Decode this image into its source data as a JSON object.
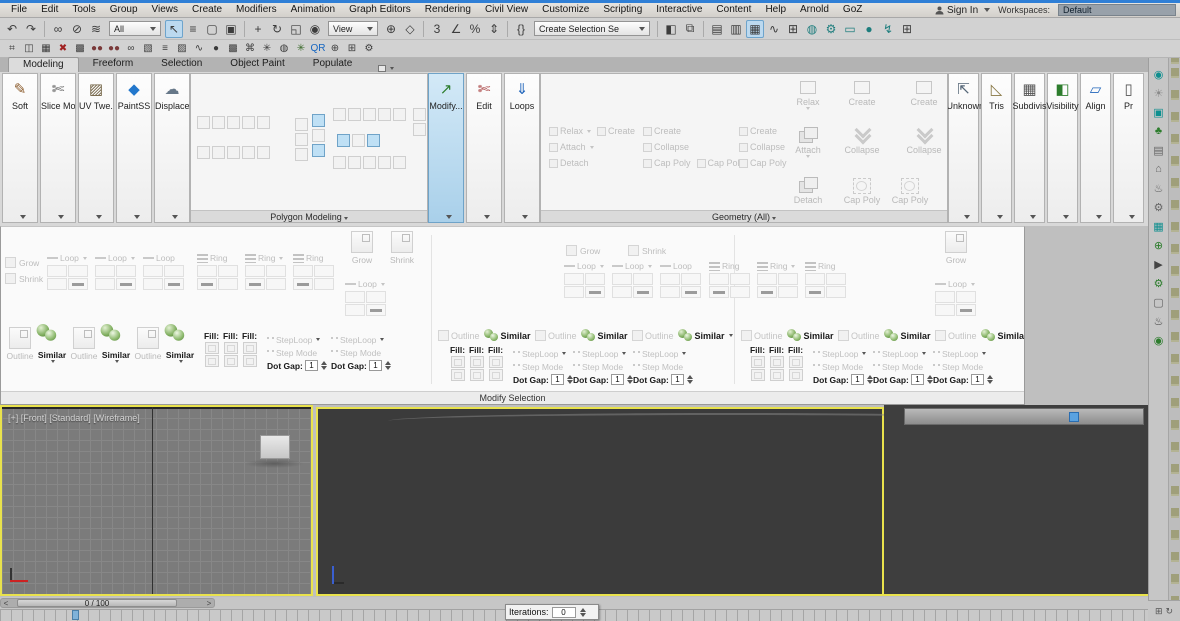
{
  "menu": {
    "items": [
      "File",
      "Edit",
      "Tools",
      "Group",
      "Views",
      "Create",
      "Modifiers",
      "Animation",
      "Graph Editors",
      "Rendering",
      "Civil View",
      "Customize",
      "Scripting",
      "Interactive",
      "Content",
      "Help",
      "Arnold",
      "GoZ"
    ],
    "sign_in": "Sign In",
    "workspaces_label": "Workspaces:",
    "workspace_value": "Default"
  },
  "toolbar": {
    "filter_value": "All",
    "coord_value": "View",
    "sets_value": "Create Selection Se",
    "group_a": [
      {
        "name": "undo-icon",
        "glyph": "↶"
      },
      {
        "name": "redo-icon",
        "glyph": "↷"
      }
    ],
    "group_b": [
      {
        "name": "select-link-icon",
        "glyph": "∞"
      },
      {
        "name": "unlink-icon",
        "glyph": "⊘"
      },
      {
        "name": "bind-spacewarp-icon",
        "glyph": "≋"
      }
    ],
    "group_c": [
      {
        "name": "select-object-icon",
        "glyph": "↖",
        "active": true
      },
      {
        "name": "select-by-name-icon",
        "glyph": "≡"
      },
      {
        "name": "rect-region-icon",
        "glyph": "▢"
      },
      {
        "name": "window-crossing-icon",
        "glyph": "▣"
      }
    ],
    "group_d": [
      {
        "name": "select-move-icon",
        "glyph": "+"
      },
      {
        "name": "select-rotate-icon",
        "glyph": "↻"
      },
      {
        "name": "select-scale-icon",
        "glyph": "◱"
      },
      {
        "name": "select-place-icon",
        "glyph": "◉"
      }
    ],
    "group_e": [
      {
        "name": "use-pivot-center-icon",
        "glyph": "⊕"
      },
      {
        "name": "select-manipulate-icon",
        "glyph": "◇"
      }
    ],
    "group_f": [
      {
        "name": "snaps-toggle-icon",
        "glyph": "3"
      },
      {
        "name": "angle-snap-icon",
        "glyph": "∠"
      },
      {
        "name": "percent-snap-icon",
        "glyph": "%"
      },
      {
        "name": "spinner-snap-icon",
        "glyph": "⇕"
      }
    ],
    "group_g": [
      {
        "name": "named-selection-sets-icon",
        "glyph": "{}"
      }
    ],
    "group_h": [
      {
        "name": "mirror-icon",
        "glyph": "◧"
      },
      {
        "name": "align-icon",
        "glyph": "⧉"
      }
    ],
    "group_i": [
      {
        "name": "scene-explorer-icon",
        "glyph": "▤"
      },
      {
        "name": "layer-explorer-icon",
        "glyph": "▥"
      },
      {
        "name": "ribbon-toggle-icon",
        "glyph": "▦",
        "active": true
      },
      {
        "name": "curve-editor-icon",
        "glyph": "∿"
      },
      {
        "name": "schematic-view-icon",
        "glyph": "⊞"
      }
    ],
    "group_j": [
      {
        "name": "material-editor-icon",
        "glyph": "◍",
        "color": "#1d7d7d"
      },
      {
        "name": "render-setup-icon",
        "glyph": "⚙",
        "color": "#1d7d7d"
      },
      {
        "name": "rendered-frame-icon",
        "glyph": "▭",
        "color": "#1d7d7d"
      },
      {
        "name": "render-production-icon",
        "glyph": "●",
        "color": "#1d7d7d"
      },
      {
        "name": "render-iterative-icon",
        "glyph": "↯",
        "color": "#1d7d7d"
      },
      {
        "name": "open-in-grid-icon",
        "glyph": "⊞",
        "color": "#444"
      }
    ]
  },
  "toolbar2": {
    "icons": [
      {
        "name": "civil-view-icon",
        "glyph": "⌗"
      },
      {
        "name": "panel-icon",
        "glyph": "◫"
      },
      {
        "name": "grid-c-icon",
        "glyph": "▦"
      },
      {
        "name": "rxyz-icon",
        "glyph": "✖",
        "color": "#a02020"
      },
      {
        "name": "dither-icon",
        "glyph": "▩"
      },
      {
        "name": "spheres-a-icon",
        "glyph": "●●",
        "color": "#7a3a3a"
      },
      {
        "name": "spheres-b-icon",
        "glyph": "●●",
        "color": "#7a3a3a"
      },
      {
        "name": "slider-icon",
        "glyph": "∞"
      },
      {
        "name": "fabric-icon",
        "glyph": "▧"
      },
      {
        "name": "cursor-list-icon",
        "glyph": "≡"
      },
      {
        "name": "pattern-icon",
        "glyph": "▨"
      },
      {
        "name": "wave-icon",
        "glyph": "∿"
      },
      {
        "name": "sphere-dark-icon",
        "glyph": "●",
        "color": "#3a3a3a"
      },
      {
        "name": "checker-icon",
        "glyph": "▩"
      },
      {
        "name": "stamp-icon",
        "glyph": "⌘"
      },
      {
        "name": "net-icon",
        "glyph": "✳"
      },
      {
        "name": "sphere-light-icon",
        "glyph": "◍"
      },
      {
        "name": "plant-icon",
        "glyph": "✳",
        "color": "#3a6a2a"
      },
      {
        "name": "qr-icon",
        "glyph": "QR",
        "color": "#1565c0"
      },
      {
        "name": "target-icon",
        "glyph": "⊕"
      },
      {
        "name": "blocks-icon",
        "glyph": "⊞"
      },
      {
        "name": "gears-icon",
        "glyph": "⚙"
      }
    ]
  },
  "tabs": {
    "items": [
      {
        "label": "Modeling",
        "active": true
      },
      {
        "label": "Freeform"
      },
      {
        "label": "Selection"
      },
      {
        "label": "Object Paint"
      },
      {
        "label": "Populate"
      }
    ]
  },
  "ribbon": {
    "left_columns": [
      {
        "label": "Soft",
        "glyph": "✎",
        "color": "#8a5a2a"
      },
      {
        "label": "Slice Mode",
        "glyph": "✄",
        "color": "#555555"
      },
      {
        "label": "UV Twe...",
        "glyph": "▨",
        "color": "#6a5a3a"
      },
      {
        "label": "PaintSS",
        "glyph": "◆",
        "color": "#2277cc"
      },
      {
        "label": "Displace...",
        "glyph": "☁",
        "color": "#667788"
      }
    ],
    "polygon_panel_label": "Polygon Modeling",
    "tool_columns": [
      {
        "label": "Modify...",
        "glyph": "↗",
        "color": "#2d7d2d",
        "active": true
      },
      {
        "label": "Edit",
        "glyph": "✄",
        "color": "#a03030"
      },
      {
        "label": "Loops",
        "glyph": "⇓",
        "color": "#2266bb"
      }
    ],
    "geometry_panel_label": "Geometry (All)",
    "geo": {
      "relax": "Relax",
      "attach": "Attach",
      "detach": "Detach",
      "create": "Create",
      "collapse": "Collapse",
      "cap_poly": "Cap Poly"
    },
    "right_columns": [
      {
        "label": "Unknown",
        "glyph": "⇱",
        "color": "#556677"
      },
      {
        "label": "Tris",
        "glyph": "◺",
        "color": "#887744"
      },
      {
        "label": "Subdivis...",
        "glyph": "▦",
        "color": "#555555"
      },
      {
        "label": "Visibility",
        "glyph": "◧",
        "color": "#2d7d2d"
      },
      {
        "label": "Align",
        "glyph": "▱",
        "color": "#2266bb"
      },
      {
        "label": "Pr",
        "glyph": "▯",
        "color": "#555555"
      }
    ]
  },
  "expanded": {
    "title": "Modify Selection",
    "grow": "Grow",
    "shrink": "Shrink",
    "loop": "Loop",
    "ring": "Ring",
    "outline": "Outline",
    "similar": "Similar",
    "fill": "Fill:",
    "steploop": "StepLoop",
    "stepmode": "Step Mode",
    "dotgap": "Dot Gap:",
    "dotgap_value": "1"
  },
  "viewport": {
    "left_label": "[+] [Front] [Standard] [Wireframe]"
  },
  "timeline": {
    "frame_label": "0 / 100",
    "prev": "<",
    "next": ">"
  },
  "iterations": {
    "label": "Iterations:",
    "value": "0"
  },
  "rail": {
    "icons": [
      {
        "name": "light-icon",
        "glyph": "◉",
        "color": "#0e8f8f"
      },
      {
        "name": "sun-icon",
        "glyph": "☀",
        "color": "#8a8a8a"
      },
      {
        "name": "camera-icon",
        "glyph": "▣",
        "color": "#0e8f8f"
      },
      {
        "name": "vegetation-icon",
        "glyph": "♣",
        "color": "#2d7d2d"
      },
      {
        "name": "table-icon",
        "glyph": "▤",
        "color": "#666666"
      },
      {
        "name": "building-icon",
        "glyph": "⌂",
        "color": "#666666"
      },
      {
        "name": "bell-icon",
        "glyph": "♨",
        "color": "#666666"
      },
      {
        "name": "gear-icon",
        "glyph": "⚙",
        "color": "#666666"
      },
      {
        "name": "monitor-icon",
        "glyph": "▦",
        "color": "#0e8f8f"
      },
      {
        "name": "crosshair-icon",
        "glyph": "⊕",
        "color": "#2d7d2d"
      },
      {
        "name": "play-icon",
        "glyph": "▶",
        "color": "#444444"
      },
      {
        "name": "gear-green-icon",
        "glyph": "⚙",
        "color": "#2d7d2d"
      },
      {
        "name": "window-icon",
        "glyph": "▢",
        "color": "#666666"
      },
      {
        "name": "teapot-icon",
        "glyph": "♨",
        "color": "#444444"
      },
      {
        "name": "lamp-icon",
        "glyph": "◉",
        "color": "#2d7d2d"
      }
    ]
  }
}
